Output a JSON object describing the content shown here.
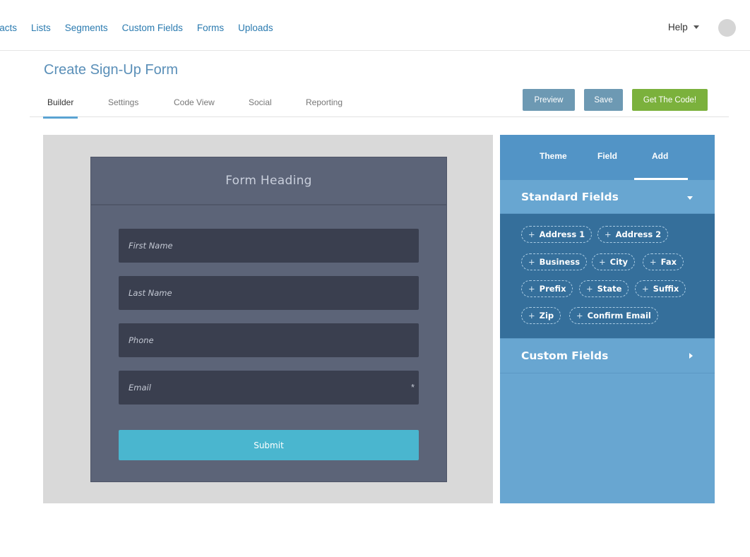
{
  "topnav": {
    "links": [
      "ntacts",
      "Lists",
      "Segments",
      "Custom Fields",
      "Forms",
      "Uploads"
    ],
    "help_label": "Help"
  },
  "page": {
    "title": "Create Sign-Up Form"
  },
  "tabs": [
    "Builder",
    "Settings",
    "Code View",
    "Social",
    "Reporting"
  ],
  "actions": {
    "preview": "Preview",
    "save": "Save",
    "get_code": "Get The Code!"
  },
  "form": {
    "heading": "Form Heading",
    "fields": [
      {
        "placeholder": "First Name",
        "required": false
      },
      {
        "placeholder": "Last Name",
        "required": false
      },
      {
        "placeholder": "Phone",
        "required": false
      },
      {
        "placeholder": "Email",
        "required": true,
        "required_mark": "*"
      }
    ],
    "submit_label": "Submit"
  },
  "panel": {
    "tabs": [
      "Theme",
      "Field",
      "Add"
    ],
    "active_tab": "Add",
    "standard_fields_label": "Standard Fields",
    "standard_fields": [
      "Address 1",
      "Address 2",
      "Business",
      "City",
      "Fax",
      "Prefix",
      "State",
      "Suffix",
      "Zip",
      "Confirm Email"
    ],
    "chip_plus": "+",
    "custom_fields_label": "Custom Fields"
  },
  "colors": {
    "link": "#2b7bb0",
    "title": "#5a8fb8",
    "preview_button": "#6d99b3",
    "get_code_button": "#7bb13c",
    "form_background": "#5c6478",
    "field_background": "#3a3f4f",
    "submit_button": "#4ab6cf",
    "panel_background": "#68a6d1",
    "panel_tabs": "#5294c6",
    "chips_background": "#356f9b"
  },
  "icons": {
    "help_caret": "chevron-down-icon",
    "standard_toggle": "chevron-down-icon",
    "custom_toggle": "chevron-right-icon",
    "avatar": "user-avatar"
  }
}
